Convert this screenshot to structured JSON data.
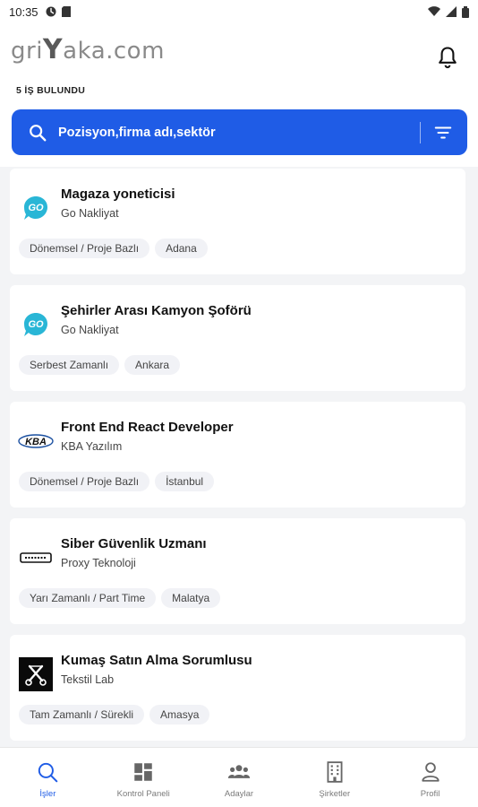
{
  "statusbar": {
    "time": "10:35"
  },
  "app": {
    "logo_left": "gri",
    "logo_mid": "Y",
    "logo_right": "aka.com"
  },
  "results_count": "5 İŞ BULUNDU",
  "search": {
    "placeholder": "Pozisyon,firma adı,sektör"
  },
  "jobs": [
    {
      "title": "Magaza yoneticisi",
      "company": "Go Nakliyat",
      "tags": [
        "Dönemsel / Proje Bazlı",
        "Adana"
      ],
      "logo": "go-logo"
    },
    {
      "title": "Şehirler Arası Kamyon Şoförü",
      "company": "Go Nakliyat",
      "tags": [
        "Serbest Zamanlı",
        "Ankara"
      ],
      "logo": "go-logo"
    },
    {
      "title": "Front End React Developer",
      "company": "KBA Yazılım",
      "tags": [
        "Dönemsel / Proje Bazlı",
        "İstanbul"
      ],
      "logo": "kba-logo"
    },
    {
      "title": "Siber Güvenlik Uzmanı",
      "company": "Proxy Teknoloji",
      "tags": [
        "Yarı Zamanlı / Part Time",
        "Malatya"
      ],
      "logo": "proxy-logo"
    },
    {
      "title": "Kumaş Satın Alma Sorumlusu",
      "company": "Tekstil Lab",
      "tags": [
        "Tam Zamanlı / Sürekli",
        "Amasya"
      ],
      "logo": "tekstil-logo"
    }
  ],
  "nav": [
    {
      "label": "İşler",
      "icon": "search-icon",
      "active": true
    },
    {
      "label": "Kontrol Paneli",
      "icon": "dashboard-icon",
      "active": false
    },
    {
      "label": "Adaylar",
      "icon": "users-icon",
      "active": false
    },
    {
      "label": "Şirketler",
      "icon": "building-icon",
      "active": false
    },
    {
      "label": "Profil",
      "icon": "person-icon",
      "active": false
    }
  ],
  "colors": {
    "accent": "#1f5ce6",
    "go_brand": "#29b6d6"
  }
}
